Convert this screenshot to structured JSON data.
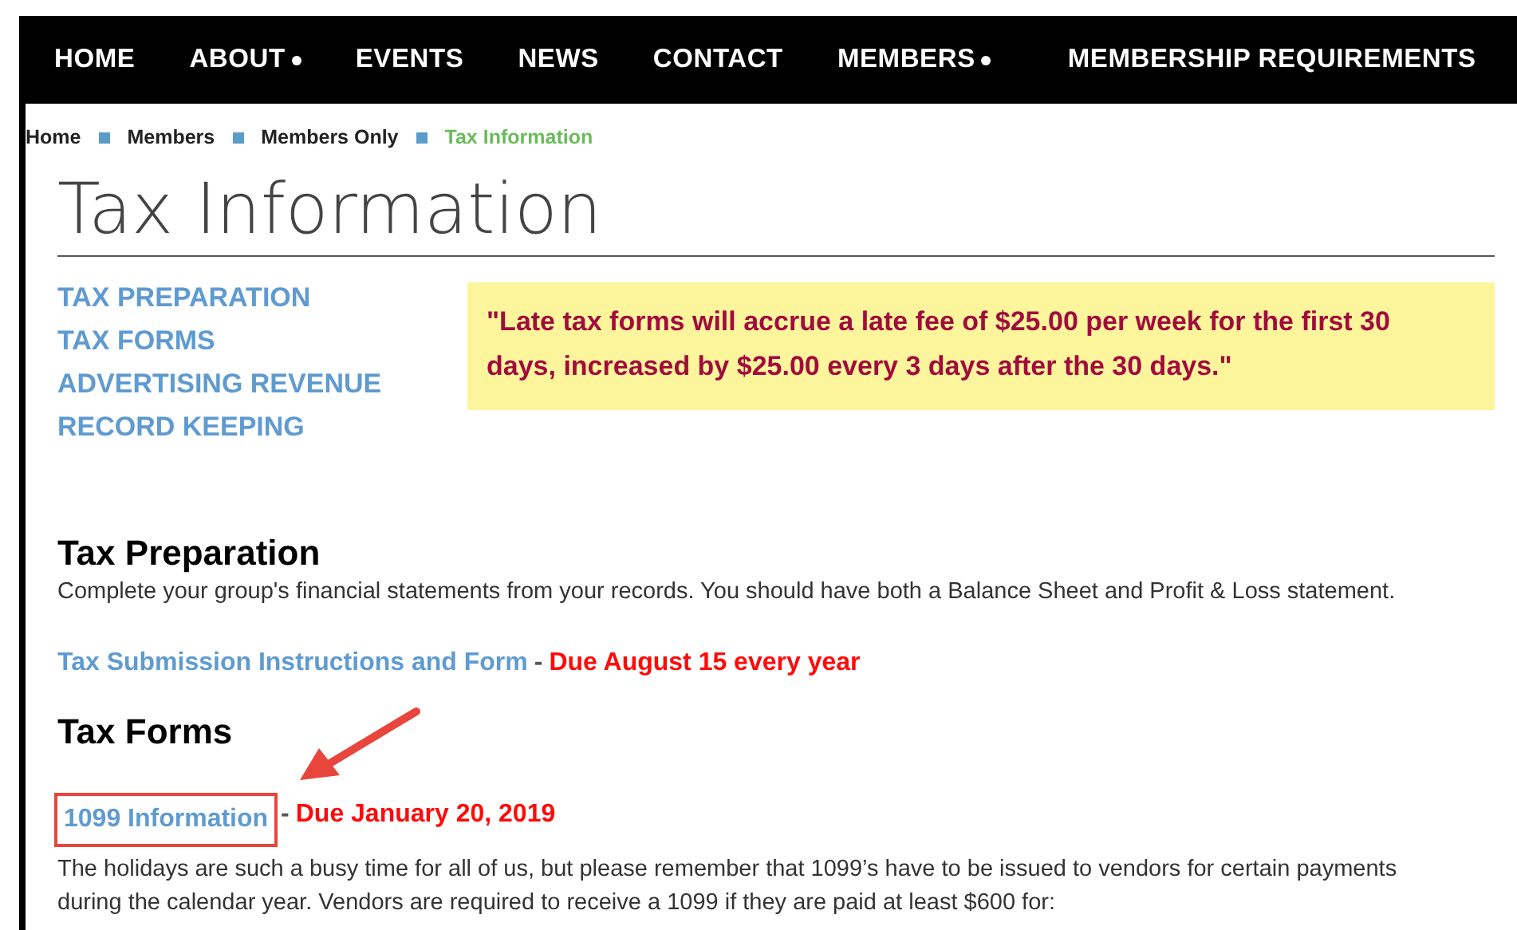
{
  "nav": [
    {
      "label": "HOME",
      "dropdown": false
    },
    {
      "label": "ABOUT",
      "dropdown": true
    },
    {
      "label": "EVENTS",
      "dropdown": false
    },
    {
      "label": "NEWS",
      "dropdown": false
    },
    {
      "label": "CONTACT",
      "dropdown": false
    },
    {
      "label": "MEMBERS",
      "dropdown": true
    },
    {
      "label": "MEMBERSHIP REQUIREMENTS",
      "dropdown": false
    }
  ],
  "breadcrumb": [
    {
      "label": "Home",
      "selected": false
    },
    {
      "label": "Members",
      "selected": false
    },
    {
      "label": "Members Only",
      "selected": false
    },
    {
      "label": "Tax Information",
      "selected": true
    }
  ],
  "title": "Tax Information",
  "section_links": [
    "TAX PREPARATION",
    "TAX FORMS",
    "ADVERTISING REVENUE",
    "RECORD KEEPING"
  ],
  "notice": "\"Late tax forms will accrue a late fee of $25.00 per week for the first 30 days, increased by $25.00 every 3 days after the 30 days.\"",
  "sections": [
    {
      "heading": "Tax Preparation",
      "intro": "Complete your group's financial statements from your records. You should have both a Balance Sheet and Profit & Loss statement.",
      "link": {
        "label": "Tax Submission Instructions and Form",
        "separator": "-",
        "due": "Due August 15 every year",
        "highlighted": false
      }
    },
    {
      "heading": "Tax Forms",
      "link": {
        "label": "1099 Information",
        "separator": "-",
        "due": "Due January 20, 2019",
        "highlighted": true
      },
      "body": [
        "The holidays are such a busy time for all of us, but please remember that 1099’s have to be issued to vendors for certain payments during the calendar year. Vendors are required to receive a 1099 if they are paid at least $600 for:"
      ]
    }
  ],
  "callout": {
    "kind": "arrow"
  }
}
